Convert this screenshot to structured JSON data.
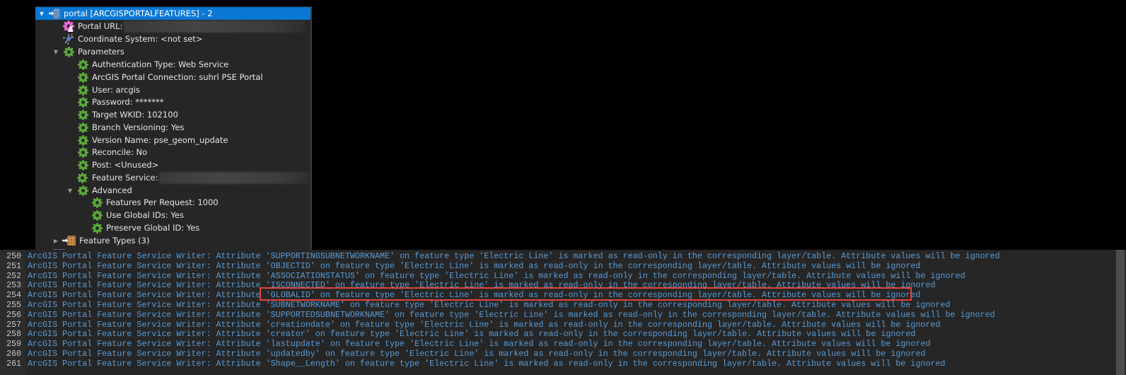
{
  "tree": {
    "root": {
      "label": "portal [ARCGISPORTALFEATURES] - 2",
      "icon": "database-writer-icon"
    },
    "portal_url": {
      "label": "Portal URL:",
      "icon": "user-gear-icon",
      "value_redacted": true
    },
    "coordinate_system": {
      "label": "Coordinate System: <not set>",
      "icon": "coordinate-system-icon"
    },
    "parameters": {
      "label": "Parameters",
      "icon": "gear-icon",
      "items": [
        {
          "label": "Authentication Type: Web Service"
        },
        {
          "label": "ArcGIS Portal Connection: suhrl PSE Portal"
        },
        {
          "label": "User: arcgis"
        },
        {
          "label": "Password: *******"
        },
        {
          "label": "Target WKID: 102100"
        },
        {
          "label": "Branch Versioning: Yes"
        },
        {
          "label": "Version Name: pse_geom_update"
        },
        {
          "label": "Reconcile: No"
        },
        {
          "label": "Post: <Unused>"
        },
        {
          "label": "Feature Service:",
          "value_redacted": true
        }
      ],
      "advanced": {
        "label": "Advanced",
        "items": [
          {
            "label": "Features Per Request: 1000"
          },
          {
            "label": "Use Global IDs: Yes"
          },
          {
            "label": "Preserve Global ID: Yes"
          }
        ]
      }
    },
    "feature_types": {
      "label": "Feature Types (3)",
      "icon": "feature-types-icon"
    }
  },
  "log": {
    "highlighted_line": 254,
    "lines": [
      {
        "num": "250",
        "text": "ArcGIS Portal Feature Service Writer: Attribute 'SUPPORTINGSUBNETWORKNAME' on feature type 'Electric Line' is marked as read-only in the corresponding layer/table. Attribute values will be ignored"
      },
      {
        "num": "251",
        "text": "ArcGIS Portal Feature Service Writer: Attribute 'OBJECTID' on feature type 'Electric Line' is marked as read-only in the corresponding layer/table. Attribute values will be ignored"
      },
      {
        "num": "252",
        "text": "ArcGIS Portal Feature Service Writer: Attribute 'ASSOCIATIONSTATUS' on feature type 'Electric Line' is marked as read-only in the corresponding layer/table. Attribute values will be ignored"
      },
      {
        "num": "253",
        "text": "ArcGIS Portal Feature Service Writer: Attribute 'ISCONNECTED' on feature type 'Electric Line' is marked as read-only in the corresponding layer/table. Attribute values will be ignored"
      },
      {
        "num": "254",
        "text": "ArcGIS Portal Feature Service Writer: Attribute 'GLOBALID' on feature type 'Electric Line' is marked as read-only in the corresponding layer/table. Attribute values will be ignored"
      },
      {
        "num": "255",
        "text": "ArcGIS Portal Feature Service Writer: Attribute 'SUBNETWORKNAME' on feature type 'Electric Line' is marked as read-only in the corresponding layer/table. Attribute values will be ignored"
      },
      {
        "num": "256",
        "text": "ArcGIS Portal Feature Service Writer: Attribute 'SUPPORTEDSUBNETWORKNAME' on feature type 'Electric Line' is marked as read-only in the corresponding layer/table. Attribute values will be ignored"
      },
      {
        "num": "257",
        "text": "ArcGIS Portal Feature Service Writer: Attribute 'creationdate' on feature type 'Electric Line' is marked as read-only in the corresponding layer/table. Attribute values will be ignored"
      },
      {
        "num": "258",
        "text": "ArcGIS Portal Feature Service Writer: Attribute 'creator' on feature type 'Electric Line' is marked as read-only in the corresponding layer/table. Attribute values will be ignored"
      },
      {
        "num": "259",
        "text": "ArcGIS Portal Feature Service Writer: Attribute 'lastupdate' on feature type 'Electric Line' is marked as read-only in the corresponding layer/table. Attribute values will be ignored"
      },
      {
        "num": "260",
        "text": "ArcGIS Portal Feature Service Writer: Attribute 'updatedby' on feature type 'Electric Line' is marked as read-only in the corresponding layer/table. Attribute values will be ignored"
      },
      {
        "num": "261",
        "text": "ArcGIS Portal Feature Service Writer: Attribute 'Shape__Length' on feature type 'Electric Line' is marked as read-only in the corresponding layer/table. Attribute values will be ignored"
      }
    ]
  },
  "colors": {
    "selection": "#0a78d4",
    "log_text": "#5b9bd5",
    "gear": "#5aa83a",
    "highlight_border": "#e0443c"
  }
}
